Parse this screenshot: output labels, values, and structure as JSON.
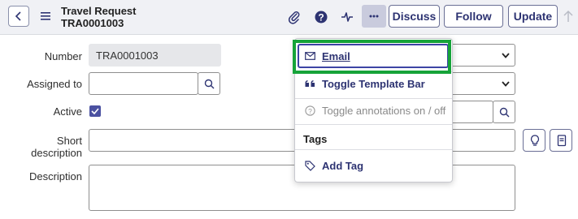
{
  "header": {
    "title": "Travel Request",
    "number": "TRA0001003",
    "buttons": {
      "discuss": "Discuss",
      "follow": "Follow",
      "update": "Update"
    },
    "icons": [
      "back-icon",
      "hamburger-icon",
      "attachment-icon",
      "help-icon",
      "activity-icon",
      "more-icon",
      "up-arrow-icon"
    ]
  },
  "form": {
    "number_label": "Number",
    "number_value": "TRA0001003",
    "assigned_to_label": "Assigned to",
    "assigned_to_value": "",
    "active_label": "Active",
    "active_checked": true,
    "short_description_label_1": "Short",
    "short_description_label_2": "description",
    "short_description_value": "",
    "description_label": "Description",
    "description_value": ""
  },
  "menu": {
    "items": [
      {
        "label": "Email",
        "icon": "envelope-icon",
        "highlighted": true
      },
      {
        "label": "Toggle Template Bar",
        "icon": "quote-icon"
      },
      {
        "label": "Toggle annotations on / off",
        "icon": "question-circle-icon",
        "disabled": true
      }
    ],
    "tags_header": "Tags",
    "add_tag": {
      "label": "Add Tag",
      "icon": "tag-icon"
    }
  },
  "colors": {
    "accent": "#2d3372",
    "checkbox": "#4b51a1",
    "highlight": "#16a339",
    "header_bg": "#f0f1f5"
  }
}
